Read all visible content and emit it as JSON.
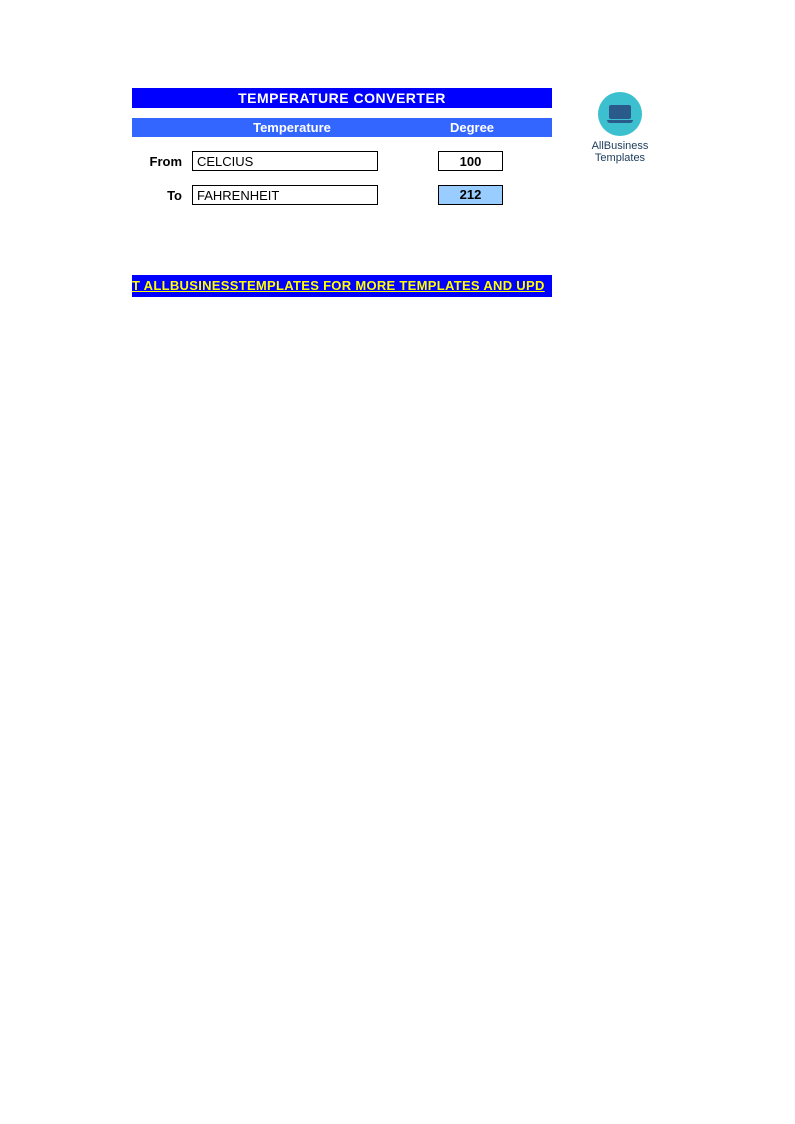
{
  "title": "TEMPERATURE CONVERTER",
  "subheader": {
    "temperature": "Temperature",
    "degree": "Degree"
  },
  "rows": {
    "from": {
      "label": "From",
      "unit": "CELCIUS",
      "value": "100"
    },
    "to": {
      "label": "To",
      "unit": "FAHRENHEIT",
      "value": "212"
    }
  },
  "footer_link": "T ALLBUSINESSTEMPLATES FOR MORE TEMPLATES AND UPD",
  "logo": {
    "line1": "AllBusiness",
    "line2": "Templates"
  }
}
